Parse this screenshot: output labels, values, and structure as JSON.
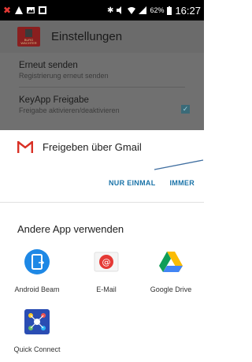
{
  "status_bar": {
    "battery": "62%",
    "time": "16:27",
    "icons": [
      "close-notification-icon",
      "warning-icon",
      "image-icon",
      "app-icon",
      "bluetooth-icon",
      "mute-icon",
      "wifi-icon",
      "signal-icon",
      "battery-icon"
    ]
  },
  "background_app": {
    "title": "Einstellungen",
    "logo_text": "BURG WÄCHTER",
    "settings": [
      {
        "title": "Erneut senden",
        "subtitle": "Registrierung erneut senden",
        "checked": false
      },
      {
        "title": "KeyApp Freigabe",
        "subtitle": "Freigabe aktivieren/deaktivieren",
        "checked": true
      }
    ]
  },
  "chooser": {
    "default_app": {
      "icon": "gmail-icon",
      "title": "Freigeben über Gmail",
      "actions": [
        "NUR EINMAL",
        "IMMER"
      ]
    },
    "other_title": "Andere App verwenden",
    "apps": [
      {
        "label": "Android Beam",
        "icon": "android-beam-icon"
      },
      {
        "label": "E-Mail",
        "icon": "email-icon"
      },
      {
        "label": "Google Drive",
        "icon": "google-drive-icon"
      },
      {
        "label": "Quick Connect",
        "icon": "quick-connect-icon"
      }
    ]
  },
  "colors": {
    "accent": "#1a73a8",
    "overlay": "#707070"
  }
}
